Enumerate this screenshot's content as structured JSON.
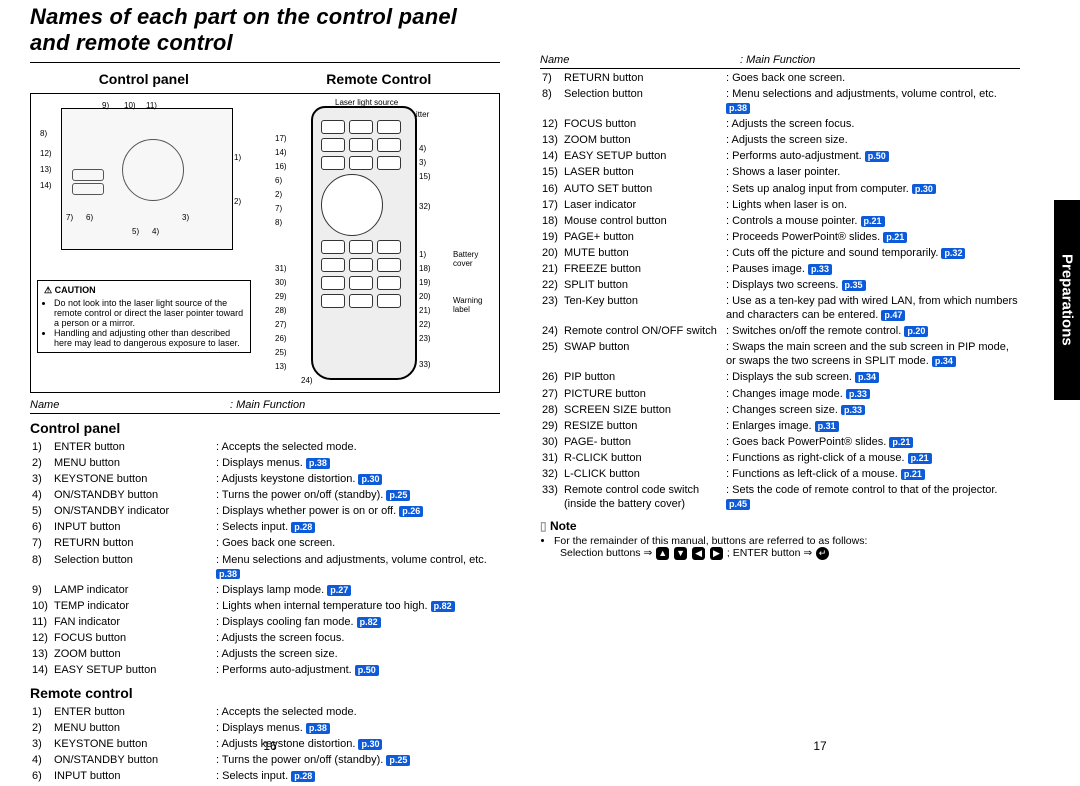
{
  "title": "Names of each part on the control panel and remote control",
  "subheads": {
    "left": "Control panel",
    "right": "Remote Control"
  },
  "diagram_labels": {
    "laser_src": "Laser light source",
    "rc_tx": "Remote control transmitter",
    "battery_cover": "Battery cover",
    "warning_label": "Warning label"
  },
  "caution": {
    "heading": "CAUTION",
    "items": [
      "Do not look into the laser light source of the remote control or direct the laser pointer toward a person or a mirror.",
      "Handling and adjusting other than described here may lead to dangerous exposure to laser."
    ]
  },
  "col_headers": {
    "name": "Name",
    "func": "Main Function"
  },
  "sections": {
    "cp_head": "Control panel",
    "rc_head": "Remote control"
  },
  "cp_rows": [
    {
      "n": "1)",
      "name": "ENTER button",
      "fn": "Accepts the selected mode."
    },
    {
      "n": "2)",
      "name": "MENU button",
      "fn": "Displays menus.",
      "p": "p.38"
    },
    {
      "n": "3)",
      "name": "KEYSTONE button",
      "fn": "Adjusts keystone distortion.",
      "p": "p.30"
    },
    {
      "n": "4)",
      "name": "ON/STANDBY button",
      "fn": "Turns the power on/off (standby).",
      "p": "p.25"
    },
    {
      "n": "5)",
      "name": "ON/STANDBY indicator",
      "fn": "Displays whether power is on or off.",
      "p": "p.26"
    },
    {
      "n": "6)",
      "name": "INPUT button",
      "fn": "Selects input.",
      "p": "p.28"
    },
    {
      "n": "7)",
      "name": "RETURN button",
      "fn": "Goes back one screen."
    },
    {
      "n": "8)",
      "name": "Selection button",
      "fn": "Menu selections and adjustments, volume control, etc.",
      "p": "p.38"
    },
    {
      "n": "9)",
      "name": "LAMP indicator",
      "fn": "Displays lamp mode.",
      "p": "p.27"
    },
    {
      "n": "10)",
      "name": "TEMP indicator",
      "fn": "Lights when internal temperature too high.",
      "p": "p.82"
    },
    {
      "n": "11)",
      "name": "FAN indicator",
      "fn": "Displays cooling fan mode.",
      "p": "p.82"
    },
    {
      "n": "12)",
      "name": "FOCUS button",
      "fn": "Adjusts the screen focus."
    },
    {
      "n": "13)",
      "name": "ZOOM button",
      "fn": "Adjusts the screen size."
    },
    {
      "n": "14)",
      "name": "EASY SETUP button",
      "fn": "Performs auto-adjustment.",
      "p": "p.50"
    }
  ],
  "rc_rows_left": [
    {
      "n": "1)",
      "name": "ENTER button",
      "fn": "Accepts the selected mode."
    },
    {
      "n": "2)",
      "name": "MENU button",
      "fn": "Displays menus.",
      "p": "p.38"
    },
    {
      "n": "3)",
      "name": "KEYSTONE button",
      "fn": "Adjusts keystone distortion.",
      "p": "p.30"
    },
    {
      "n": "4)",
      "name": "ON/STANDBY button",
      "fn": "Turns the power on/off (standby).",
      "p": "p.25"
    },
    {
      "n": "6)",
      "name": "INPUT button",
      "fn": "Selects input.",
      "p": "p.28"
    }
  ],
  "rc_rows_right": [
    {
      "n": "7)",
      "name": "RETURN button",
      "fn": "Goes back one screen."
    },
    {
      "n": "8)",
      "name": "Selection button",
      "fn": "Menu selections and adjustments, volume control, etc.",
      "p": "p.38"
    },
    {
      "n": "12)",
      "name": "FOCUS button",
      "fn": "Adjusts the screen focus."
    },
    {
      "n": "13)",
      "name": "ZOOM button",
      "fn": "Adjusts the screen size."
    },
    {
      "n": "14)",
      "name": "EASY SETUP button",
      "fn": "Performs auto-adjustment.",
      "p": "p.50"
    },
    {
      "n": "15)",
      "name": "LASER button",
      "fn": "Shows a laser pointer."
    },
    {
      "n": "16)",
      "name": "AUTO SET button",
      "fn": "Sets up analog input from computer.",
      "p": "p.30"
    },
    {
      "n": "17)",
      "name": "Laser indicator",
      "fn": "Lights when laser is on."
    },
    {
      "n": "18)",
      "name": "Mouse control button",
      "fn": "Controls a mouse pointer.",
      "p": "p.21"
    },
    {
      "n": "19)",
      "name": "PAGE+ button",
      "fn": "Proceeds PowerPoint® slides.",
      "p": "p.21"
    },
    {
      "n": "20)",
      "name": "MUTE button",
      "fn": "Cuts off the picture and sound temporarily.",
      "p": "p.32"
    },
    {
      "n": "21)",
      "name": "FREEZE button",
      "fn": "Pauses image.",
      "p": "p.33"
    },
    {
      "n": "22)",
      "name": "SPLIT button",
      "fn": "Displays two screens.",
      "p": "p.35"
    },
    {
      "n": "23)",
      "name": "Ten-Key button",
      "fn": "Use as a ten-key pad with wired LAN, from which numbers and characters can be entered.",
      "p": "p.47"
    },
    {
      "n": "24)",
      "name": "Remote control ON/OFF switch",
      "fn": "Switches on/off the remote control.",
      "p": "p.20"
    },
    {
      "n": "25)",
      "name": "SWAP button",
      "fn": "Swaps the main screen and the sub screen in PIP mode, or swaps the two screens in SPLIT mode.",
      "p": "p.34"
    },
    {
      "n": "26)",
      "name": "PIP button",
      "fn": "Displays the sub screen.",
      "p": "p.34"
    },
    {
      "n": "27)",
      "name": "PICTURE button",
      "fn": "Changes image mode.",
      "p": "p.33"
    },
    {
      "n": "28)",
      "name": "SCREEN SIZE button",
      "fn": "Changes screen size.",
      "p": "p.33"
    },
    {
      "n": "29)",
      "name": "RESIZE button",
      "fn": "Enlarges image.",
      "p": "p.31"
    },
    {
      "n": "30)",
      "name": "PAGE- button",
      "fn": "Goes back PowerPoint® slides.",
      "p": "p.21"
    },
    {
      "n": "31)",
      "name": "R-CLICK button",
      "fn": "Functions as right-click of a mouse.",
      "p": "p.21"
    },
    {
      "n": "32)",
      "name": "L-CLICK button",
      "fn": "Functions as left-click of a mouse.",
      "p": "p.21"
    },
    {
      "n": "33)",
      "name": "Remote control code switch (inside the battery cover)",
      "fn": "Sets the code of remote control to that of the projector.",
      "p": "p.45"
    }
  ],
  "note": {
    "head": "Note",
    "line1": "For the remainder of this manual, buttons are referred to as follows:",
    "line2_pre": "Selection buttons ⇒ ",
    "line2_mid": "; ENTER button ⇒ "
  },
  "side_tab": "Preparations",
  "page_left": "16",
  "page_right": "17"
}
